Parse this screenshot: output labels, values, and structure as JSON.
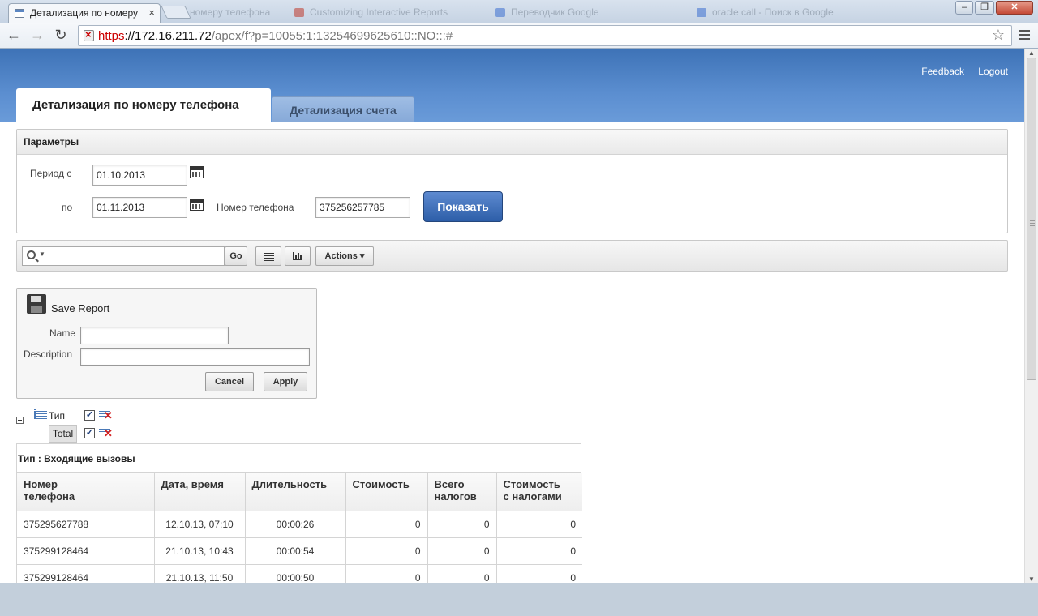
{
  "browser": {
    "active_tab_title": "Детализация по номеру ",
    "ghost_tabs": [
      "номеру телефона",
      "Customizing Interactive Reports",
      "Переводчик Google",
      "oracle call - Поиск в Google"
    ],
    "url_protocol": "https",
    "url_host": "://172.16.211.72",
    "url_path": "/apex/f?p=10055:1:13254699625610::NO:::#",
    "close_symbol": "×"
  },
  "header": {
    "links": [
      "Feedback",
      "Logout"
    ],
    "tabs": [
      "Детализация по номеру телефона",
      "Детализация счета"
    ]
  },
  "params": {
    "title": "Параметры",
    "period_from_label": "Период с",
    "period_from_value": "01.10.2013",
    "period_to_label": "по",
    "period_to_value": "01.11.2013",
    "phone_label": "Номер телефона",
    "phone_value": "375256257785",
    "submit_label": "Показать"
  },
  "ir": {
    "go_label": "Go",
    "actions_label": "Actions ▾"
  },
  "save_report": {
    "title": "Save Report",
    "name_label": "Name",
    "name_value": "",
    "description_label": "Description",
    "description_value": "",
    "cancel_label": "Cancel",
    "apply_label": "Apply"
  },
  "control_break": {
    "column_label": "Тип",
    "total_label": "Total",
    "check": "✓"
  },
  "report": {
    "group_title": "Тип : Входящие вызовы",
    "columns": [
      "Номер\nтелефона",
      "Дата, время",
      "Длительность",
      "Стоимость",
      "Всего\nналогов",
      "Стоимость\nс налогами"
    ],
    "rows": [
      [
        "375295627788",
        "12.10.13, 07:10",
        "00:00:26",
        "0",
        "0",
        "0"
      ],
      [
        "375299128464",
        "21.10.13, 10:43",
        "00:00:54",
        "0",
        "0",
        "0"
      ],
      [
        "375299128464",
        "21.10.13, 11:50",
        "00:00:50",
        "0",
        "0",
        "0"
      ]
    ]
  },
  "colors": {
    "header_blue": "#4a7fc2",
    "primary_button": "#2d5ea8"
  }
}
